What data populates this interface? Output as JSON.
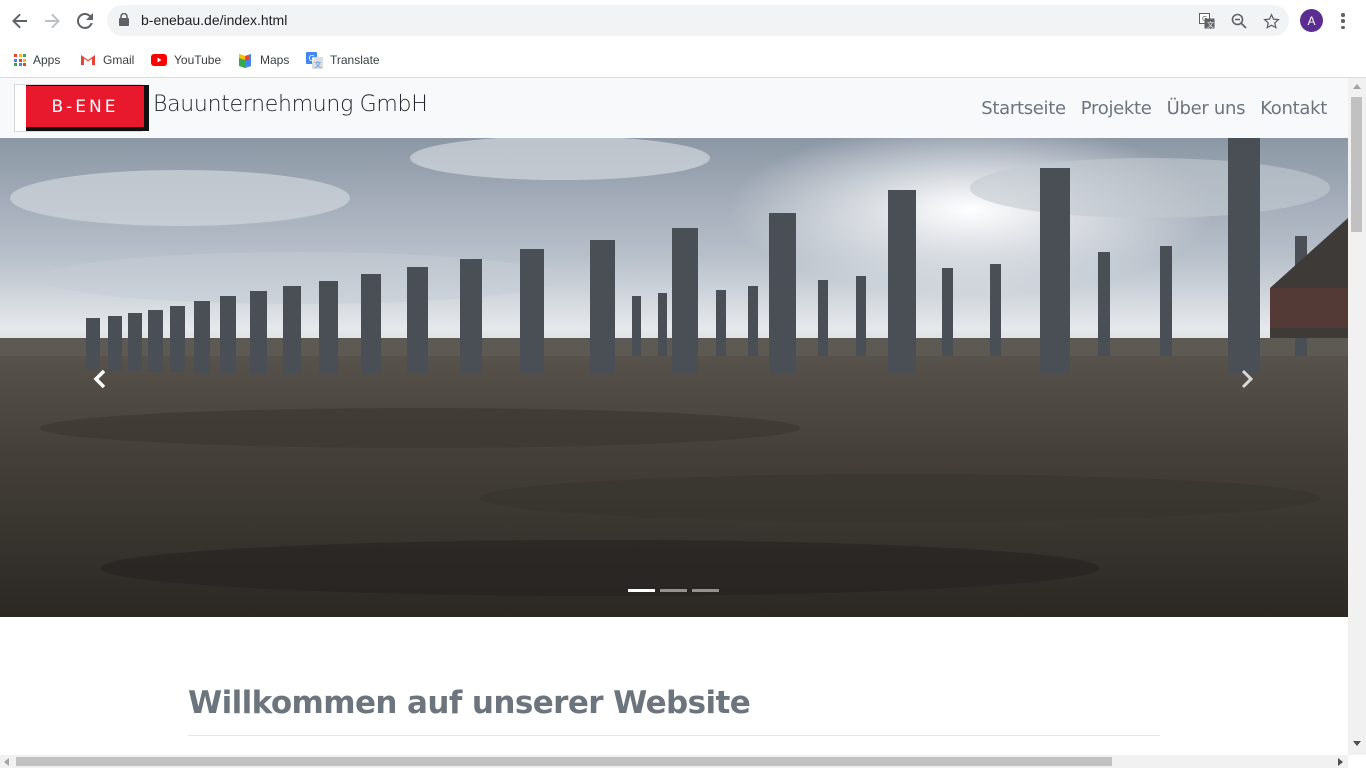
{
  "browser": {
    "url": "b-enebau.de/index.html",
    "avatar_letter": "A",
    "bookmarks": [
      {
        "label": "Apps",
        "icon": "apps-grid-icon"
      },
      {
        "label": "Gmail",
        "icon": "gmail-icon"
      },
      {
        "label": "YouTube",
        "icon": "youtube-icon"
      },
      {
        "label": "Maps",
        "icon": "maps-icon"
      },
      {
        "label": "Translate",
        "icon": "translate-icon"
      }
    ]
  },
  "site": {
    "logo_text": "B-ENE",
    "brand": "Bauunternehmung GmbH",
    "nav": [
      "Startseite",
      "Projekte",
      "Über uns",
      "Kontakt"
    ],
    "welcome_heading": "Willkommen auf unserer Website"
  },
  "carousel": {
    "slide_count": 3,
    "active_slide": 1,
    "prev_icon": "chevron-left-icon",
    "next_icon": "chevron-right-icon"
  },
  "colors": {
    "logo_red": "#e8192c",
    "nav_text": "#6c757d",
    "avatar": "#5b2d91"
  }
}
